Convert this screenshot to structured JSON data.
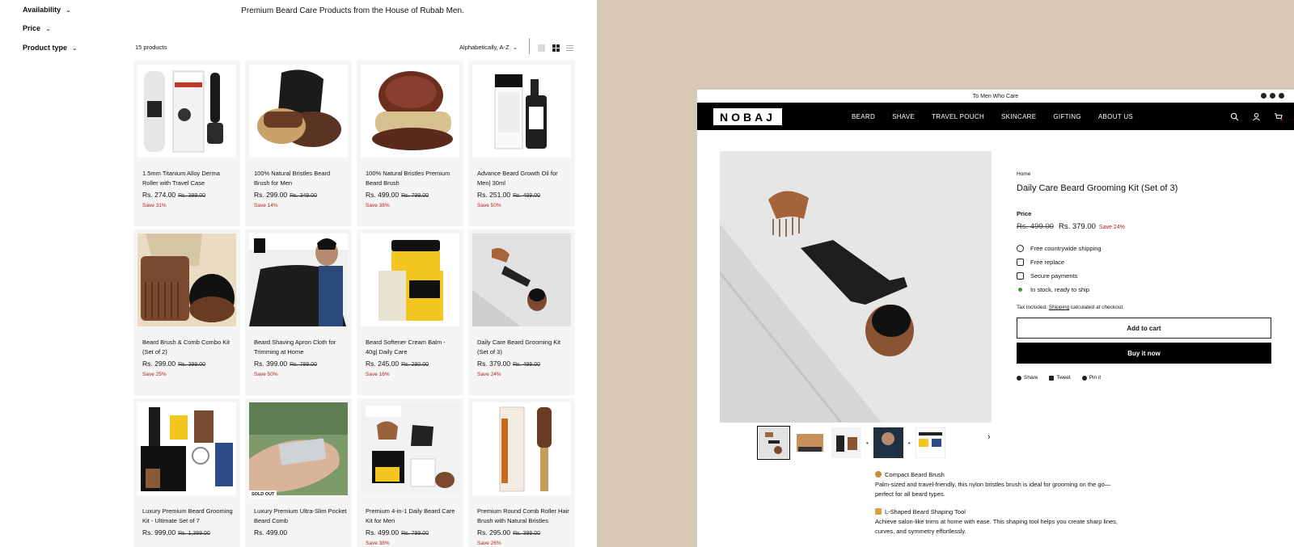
{
  "collection": {
    "filters": [
      "Availability",
      "Price",
      "Product type"
    ],
    "banner": "Premium Beard Care Products from the House of Rubab Men.",
    "count": "15 products",
    "sort": "Alphabetically, A-Z",
    "products": [
      {
        "name": "1.5mm Titanium Alloy Derma Roller with Travel Case",
        "price": "Rs. 274.00",
        "old": "Rs. 399.00",
        "save": "Save 31%",
        "badge": ""
      },
      {
        "name": "100% Natural Bristles Beard Brush for Men",
        "price": "Rs. 299.00",
        "old": "Rs. 349.00",
        "save": "Save 14%",
        "badge": ""
      },
      {
        "name": "100% Natural Bristles Premium Beard Brush",
        "price": "Rs. 499.00",
        "old": "Rs. 799.00",
        "save": "Save 38%",
        "badge": ""
      },
      {
        "name": "Advance Beard Growth Oil for Men| 30ml",
        "price": "Rs. 251.00",
        "old": "Rs. 499.00",
        "save": "Save 50%",
        "badge": ""
      },
      {
        "name": "Beard Brush & Comb Combo Kit (Set of 2)",
        "price": "Rs. 299.00",
        "old": "Rs. 399.00",
        "save": "Save 25%",
        "badge": ""
      },
      {
        "name": "Beard Shaving Apron Cloth for Trimming at Home",
        "price": "Rs. 399.00",
        "old": "Rs. 799.00",
        "save": "Save 50%",
        "badge": ""
      },
      {
        "name": "Beard Softener Cream Balm - 40g| Daily Care",
        "price": "Rs. 245.00",
        "old": "Rs. 290.00",
        "save": "Save 16%",
        "badge": ""
      },
      {
        "name": "Daily Care Beard Grooming Kit (Set of 3)",
        "price": "Rs. 379.00",
        "old": "Rs. 499.00",
        "save": "Save 24%",
        "badge": ""
      },
      {
        "name": "Luxury Premium Beard Grooming Kit - Ultimate Set of 7",
        "price": "Rs. 999.00",
        "old": "Rs. 1,399.00",
        "save": "",
        "badge": ""
      },
      {
        "name": "Luxury Premium Ultra-Slim Pocket Beard Comb",
        "price": "Rs. 499.00",
        "old": "",
        "save": "",
        "badge": "SOLD OUT"
      },
      {
        "name": "Premium 4-in-1 Daily Beard Care Kit for Men",
        "price": "Rs. 499.00",
        "old": "Rs. 799.00",
        "save": "Save 38%",
        "badge": ""
      },
      {
        "name": "Premium Round Comb Roller Hair Brush with Natural Bristles",
        "price": "Rs. 295.00",
        "old": "Rs. 399.00",
        "save": "Save 26%",
        "badge": ""
      }
    ]
  },
  "product_page": {
    "announcement": "To Men Who Care",
    "logo": "NOBAJ",
    "menu": [
      "BEARD",
      "SHAVE",
      "TRAVEL POUCH",
      "SKINCARE",
      "GIFTING",
      "ABOUT US"
    ],
    "breadcrumb": "Home",
    "title": "Daily Care Beard Grooming Kit (Set of 3)",
    "price_label": "Price",
    "old_price": "Rs. 499.00",
    "price": "Rs. 379.00",
    "save": "Save 24%",
    "features": [
      "Free countrywide shipping",
      "Free replace",
      "Secure payments",
      "In stock, ready to ship"
    ],
    "tax_pre": "Tax included.",
    "tax_link": "Shipping",
    "tax_post": "calculated at checkout.",
    "add_to_cart": "Add to cart",
    "buy_now": "Buy it now",
    "share": [
      "Share",
      "Tweet",
      "Pin it"
    ],
    "description": [
      {
        "heading": "Compact Beard Brush",
        "text": "Palm-sized and travel-friendly, this nylon bristles brush is ideal for grooming on the go—perfect for all beard types."
      },
      {
        "heading": "L-Shaped Beard Shaping Tool",
        "text": "Achieve salon-like trims at home with ease. This shaping tool helps you create sharp lines, curves, and symmetry effortlessly."
      }
    ]
  },
  "colors": {
    "accent": "#000000",
    "save": "#b02020",
    "background_panel": "#d8c8b6",
    "in_stock": "#3a9c3a"
  }
}
